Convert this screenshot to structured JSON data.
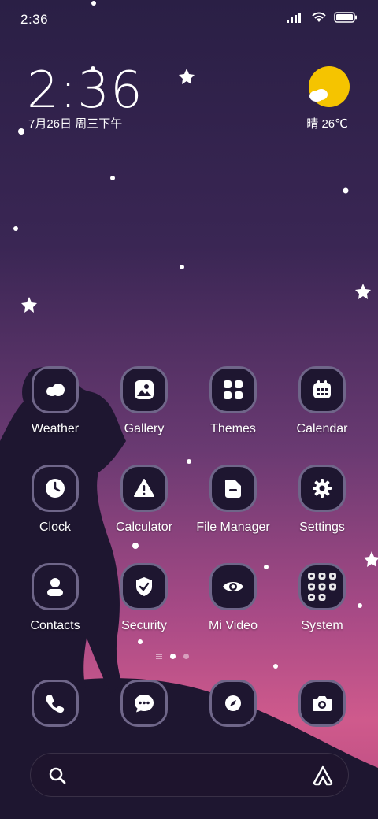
{
  "status_bar": {
    "time": "2:36"
  },
  "clock_widget": {
    "time": "2:36",
    "date": "7月26日 周三下午"
  },
  "weather_widget": {
    "text": "晴 26℃",
    "icon": "sun-cloud-icon"
  },
  "apps_row1": [
    {
      "label": "Weather",
      "icon": "weather-icon"
    },
    {
      "label": "Gallery",
      "icon": "gallery-icon"
    },
    {
      "label": "Themes",
      "icon": "themes-icon"
    },
    {
      "label": "Calendar",
      "icon": "calendar-icon"
    }
  ],
  "apps_row2": [
    {
      "label": "Clock",
      "icon": "clock-icon"
    },
    {
      "label": "Calculator",
      "icon": "warning-icon"
    },
    {
      "label": "File Manager",
      "icon": "folder-icon"
    },
    {
      "label": "Settings",
      "icon": "gear-icon"
    }
  ],
  "apps_row3": [
    {
      "label": "Contacts",
      "icon": "person-icon"
    },
    {
      "label": "Security",
      "icon": "shield-icon"
    },
    {
      "label": "Mi Video",
      "icon": "eye-icon"
    },
    {
      "label": "System",
      "icon": "folder-grid-icon"
    }
  ],
  "dock": [
    {
      "icon": "phone-icon"
    },
    {
      "icon": "messages-icon"
    },
    {
      "icon": "compass-icon"
    },
    {
      "icon": "camera-icon"
    }
  ],
  "colors": {
    "icon_bg": "#1e1630",
    "icon_border": "#6f6689",
    "sun": "#f5c400"
  }
}
